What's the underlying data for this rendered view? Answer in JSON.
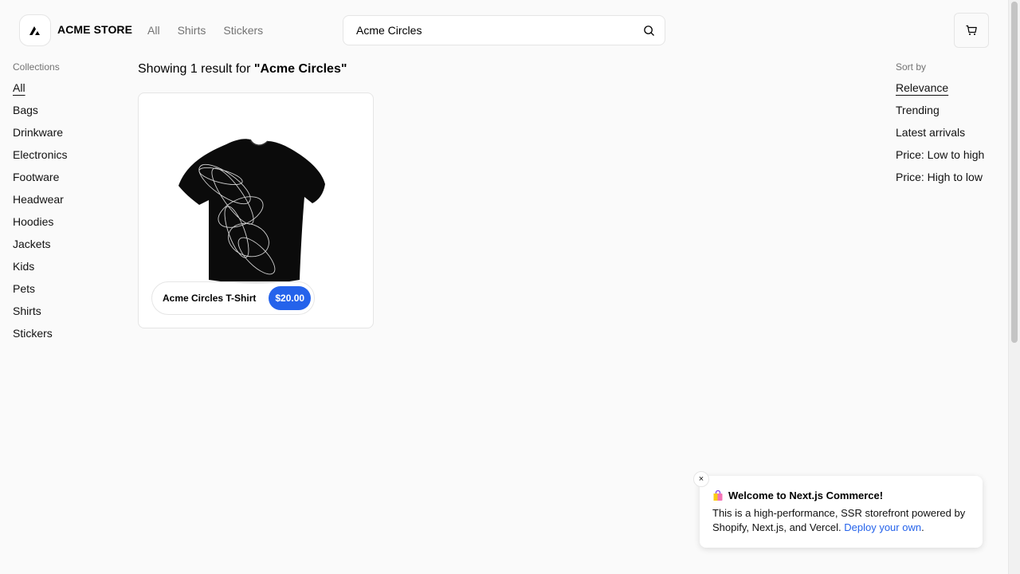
{
  "header": {
    "store_name": "ACME STORE",
    "nav": [
      "All",
      "Shirts",
      "Stickers"
    ],
    "search_value": "Acme Circles"
  },
  "collections": {
    "title": "Collections",
    "items": [
      "All",
      "Bags",
      "Drinkware",
      "Electronics",
      "Footware",
      "Headwear",
      "Hoodies",
      "Jackets",
      "Kids",
      "Pets",
      "Shirts",
      "Stickers"
    ],
    "active": "All"
  },
  "sort": {
    "title": "Sort by",
    "items": [
      "Relevance",
      "Trending",
      "Latest arrivals",
      "Price: Low to high",
      "Price: High to low"
    ],
    "active": "Relevance"
  },
  "results": {
    "prefix": "Showing 1 result for ",
    "query": "\"Acme Circles\""
  },
  "products": [
    {
      "name": "Acme Circles T-Shirt",
      "price": "$20.00"
    }
  ],
  "toast": {
    "title": "Welcome to Next.js Commerce!",
    "body": "This is a high-performance, SSR storefront powered by Shopify, Next.js, and Vercel. ",
    "link": "Deploy your own",
    "close": "×"
  },
  "colors": {
    "accent": "#2563eb",
    "background": "#fafafa"
  },
  "icons": [
    "acme-logo-icon",
    "search-icon",
    "cart-icon",
    "close-icon",
    "shopping-bag-icon"
  ]
}
